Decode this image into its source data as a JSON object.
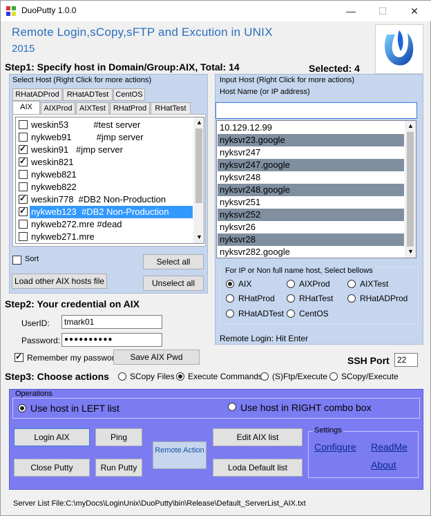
{
  "window": {
    "title": "DuoPutty 1.0.0",
    "minimize": "—",
    "maximize": "☐",
    "close": "✕"
  },
  "header": {
    "banner": "Remote Login,sCopy,sFTP and Excution in UNIX",
    "year": "2015"
  },
  "step1": {
    "text": "Step1: Specify host in Domain/Group:AIX, Total: 14",
    "selected": "Selected: 4"
  },
  "left": {
    "caption": "Select Host (Right Click for more actions)",
    "tabs_row1": [
      "RHatADProd",
      "RHatADTest",
      "CentOS"
    ],
    "tabs_row2": [
      "AIX",
      "AIXProd",
      "AIXTest",
      "RHatProd",
      "RHatTest"
    ],
    "hosts": [
      {
        "label": "weskin53          #test server",
        "checked": false
      },
      {
        "label": "nykweb91          #jmp server",
        "checked": false
      },
      {
        "label": "weskin91   #jmp server",
        "checked": true
      },
      {
        "label": "weskin821",
        "checked": true
      },
      {
        "label": "nykweb821",
        "checked": false
      },
      {
        "label": "nykweb822",
        "checked": false
      },
      {
        "label": "weskin778  #DB2 Non-Production",
        "checked": true
      },
      {
        "label": "nykweb123  #DB2 Non-Production",
        "checked": true
      },
      {
        "label": "nykweb272.mre #dead",
        "checked": false
      },
      {
        "label": "nykweb271.mre",
        "checked": false
      }
    ],
    "sort": "Sort",
    "select_all": "Select all",
    "load_other": "Load other AIX hosts file",
    "unselect_all": "Unselect all"
  },
  "right": {
    "caption": "Input Host (Right Click for more actions)",
    "host_label": "Host Name (or IP address)",
    "host_value": "",
    "list": [
      {
        "label": "10.129.12.99",
        "dark": false
      },
      {
        "label": "nyksvr23.google",
        "dark": true
      },
      {
        "label": "nyksvr247",
        "dark": false
      },
      {
        "label": "nyksvr247.google",
        "dark": true
      },
      {
        "label": "nyksvr248",
        "dark": false
      },
      {
        "label": "nyksvr248.google",
        "dark": true
      },
      {
        "label": "nyksvr251",
        "dark": false
      },
      {
        "label": "nyksvr252",
        "dark": true
      },
      {
        "label": "nyksvr26",
        "dark": false
      },
      {
        "label": "nyksvr28",
        "dark": true
      },
      {
        "label": "nyksvr282.google",
        "dark": false
      }
    ],
    "domain_caption": "For IP or Non full name host, Select bellows",
    "domains": [
      {
        "label": "AIX",
        "on": true
      },
      {
        "label": "AIXProd",
        "on": false
      },
      {
        "label": "AIXTest",
        "on": false
      },
      {
        "label": "RHatProd",
        "on": false
      },
      {
        "label": "RHatTest",
        "on": false
      },
      {
        "label": "RHatADProd",
        "on": false
      },
      {
        "label": "RHatADTest",
        "on": false
      },
      {
        "label": "CentOS",
        "on": false
      }
    ],
    "hint": "Remote Login: Hit Enter"
  },
  "step2": {
    "text": "Step2: Your credential on AIX",
    "userid_label": "UserID:",
    "userid_value": "tmark01",
    "password_label": "Password:",
    "password_value": "●●●●●●●●●●",
    "remember": "Remember my password",
    "save_pwd": "Save AIX Pwd",
    "ssh_port_label": "SSH Port",
    "ssh_port_value": "22"
  },
  "step3": {
    "text": "Step3: Choose actions",
    "actions": [
      {
        "label": "SCopy Files",
        "on": false
      },
      {
        "label": "Execute Commands",
        "on": true
      },
      {
        "label": "(S)Ftp/Execute",
        "on": false
      },
      {
        "label": "SCopy/Execute",
        "on": false
      }
    ]
  },
  "operations": {
    "caption": "Operations",
    "left_radio": "Use host in LEFT list",
    "right_radio": "Use host in RIGHT combo box",
    "login": "Login AIX",
    "ping": "Ping",
    "remote_action": "Remote Action",
    "edit_list": "Edit AIX list",
    "close_putty": "Close Putty",
    "run_putty": "Run Putty",
    "load_default": "Loda Default list",
    "settings_caption": "Settings",
    "configure": "Configure",
    "readme": "ReadMe",
    "about": "About"
  },
  "status": "Server List File:C:\\myDocs\\LoginUnix\\DuoPutty\\bin\\Release\\Default_ServerList_AIX.txt",
  "colors": {
    "panel": "#c5d6ee",
    "operations": "#7b7bf2",
    "selected_row": "#3399ff",
    "dark_row": "#7f8fa0",
    "banner": "#2a6ebb"
  }
}
